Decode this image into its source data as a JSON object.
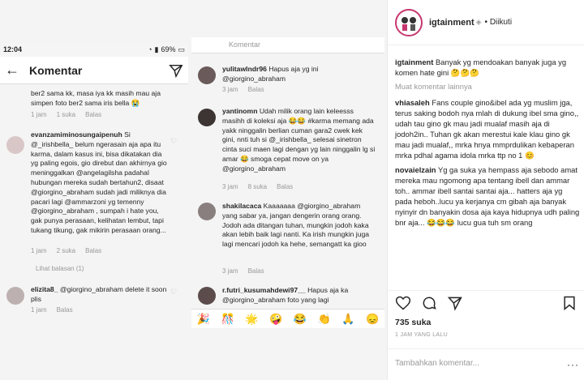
{
  "status_bar": {
    "time": "12:04",
    "battery": "69%"
  },
  "left_phone": {
    "title": "Komentar",
    "comments": [
      {
        "text": "ber2 sama kk, masa iya kk masih mau aja simpen foto ber2 sama iris bella 😭",
        "likes": "1 suka",
        "time": "1 jam",
        "reply": "Balas"
      },
      {
        "user": "evanzamiminosungaipenuh",
        "text": "Si @_irishbella_ belum ngerasain aja apa itu karma, dalam kasus ini, bisa dikatakan dia yg paling egois, gio direbut dan akhirnya gio meninggalkan @angelagilsha padahal hubungan mereka sudah bertahun2, disaat @giorgino_abraham sudah jadi miliknya dia pacari lagi @ammarzoni yg temenny @giorgino_abraham , sumpah i hate you, gak punya perasaan, kelihatan lembut, tapi tukang tikung, gak mikirin perasaan orang...",
        "likes": "2 suka",
        "time": "1 jam",
        "reply": "Balas",
        "view_replies": "Lihat balasan (1)"
      },
      {
        "user": "elizita8_",
        "text": "@giorgino_abraham delete it soon plis",
        "time": "1 jam",
        "reply": "Balas"
      }
    ]
  },
  "right_phone": {
    "header": "Komentar",
    "comments": [
      {
        "user": "yulitawlndr96",
        "text": "Hapus aja yg ini @giorgino_abraham",
        "time": "3 jam",
        "reply": "Balas"
      },
      {
        "user": "yantinomn",
        "text": "Udah milik orang lain keleesss masihh di koleksi aja 😂😂 #karma memang ada yakk ninggalin berlian cuman gara2 cwek kek gini, nnti tuh si @_irishbella_ selesai sinetron cinta suci maen lagi dengan yg lain ninggalin lg si amar 😂 smoga cepat move on ya @giorgino_abraham",
        "time": "3 jam",
        "likes": "8 suka",
        "reply": "Balas"
      },
      {
        "user": "shakilacaca",
        "text": "Kaaaaaaa @giorgino_abraham yang sabar ya, jangan dengerin orang orang. Jodoh ada ditangan tuhan, mungkin jodoh kaka akan lebih baik lagi nanti. Ka irish mungkin juga lagi mencari jodoh ka hehe, semangatt ka gioo",
        "time": "3 jam",
        "reply": "Balas"
      },
      {
        "user": "r.futri_kusumahdewi97__",
        "text": "Hapus aja ka @giorgino_abraham foto yang lagi"
      }
    ],
    "emojis": [
      "🎉",
      "🎊",
      "🌟",
      "🤪",
      "😂",
      "👏",
      "🙏",
      "😞"
    ]
  },
  "sidebar": {
    "account": "igtainment",
    "follow_label": "• Diikuti",
    "comments": [
      {
        "user": "igtainment",
        "text": "Banyak yg mendoakan banyak juga yg komen hate gini 🤔🤔🤔"
      },
      {
        "user": "vhiasaleh",
        "text": "Fans couple gino&ibel ada yg muslim jga, terus saking bodoh nya mlah di dukung ibel sma gino,, udah tau gino gk mau jadi mualaf masih aja di jodoh2in.. Tuhan gk akan merestui kale klau gino gk mau jadi mualaf,, mrka hnya mmprdulikan kebaperan mrka pdhal agama idola mrka ttp no 1 😊"
      },
      {
        "user": "novaielzain",
        "text": "Yg ga suka ya hempass aja sebodo amat mereka mau ngomong apa tentang ibell dan ammar toh.. ammar ibell santai santai aja... hatters aja yg pada heboh..lucu ya kerjanya cm gibah aja banyak nyinyir dn banyakin dosa aja kaya hidupnya udh paling bnr aja... 😂😂😂 lucu gua tuh sm orang"
      }
    ],
    "more_comments": "Muat komentar lainnya",
    "likes": "735 suka",
    "time_ago": "1 JAM YANG LALU",
    "add_comment_placeholder": "Tambahkan komentar...",
    "dots": "···"
  },
  "colors": {
    "mention": "#1c3c87",
    "muted": "#999999",
    "ring": "#c7376f"
  }
}
